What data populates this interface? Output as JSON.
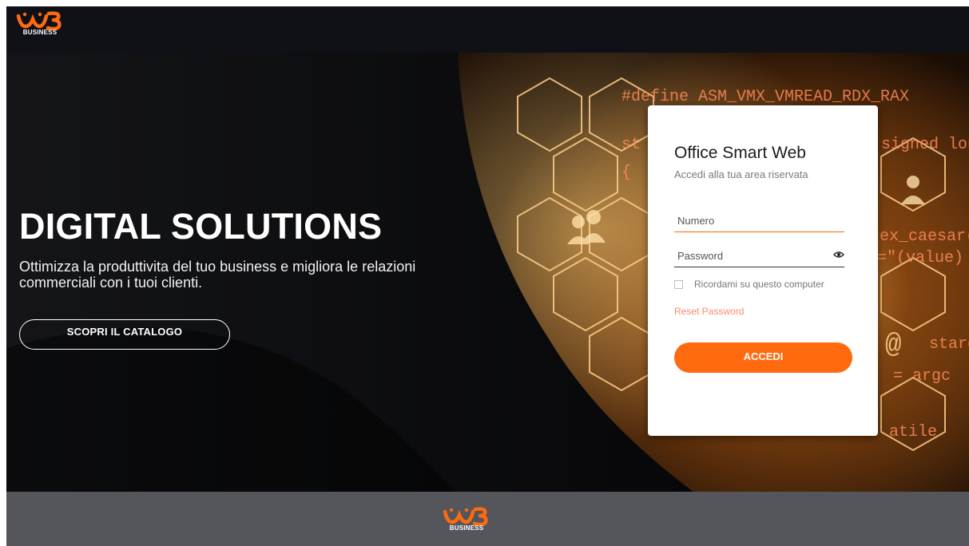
{
  "header": {
    "logo_text": "BUSINESS"
  },
  "hero": {
    "title": "DIGITAL SOLUTIONS",
    "subtitle": "Ottimizza la produttivita del tuo business e migliora le relazioni commerciali con i tuoi clienti.",
    "cta_label": "SCOPRI IL CATALOGO",
    "code_fragments": [
      "#define ASM_VMX_VMREAD_RDX_RAX",
      "signed lon",
      "ex_caesar(AS",
      "=\"(value)",
      "starg",
      "= argc",
      "atile",
      "st",
      "{",
      "@"
    ]
  },
  "login": {
    "title": "Office Smart Web",
    "subtitle": "Accedi alla tua area riservata",
    "numero_placeholder": "Numero",
    "password_placeholder": "Password",
    "remember_label": "Ricordami su questo computer",
    "reset_label": "Reset Password",
    "submit_label": "ACCEDI"
  },
  "footer": {
    "logo_text": "BUSINESS"
  },
  "colors": {
    "accent": "#ff6a0f",
    "header_bg": "#0f1116",
    "footer_bg": "#54565b",
    "reset_link": "#ff8a66"
  },
  "icons": [
    "w3-logo-icon",
    "eye-icon",
    "checkbox-icon"
  ]
}
